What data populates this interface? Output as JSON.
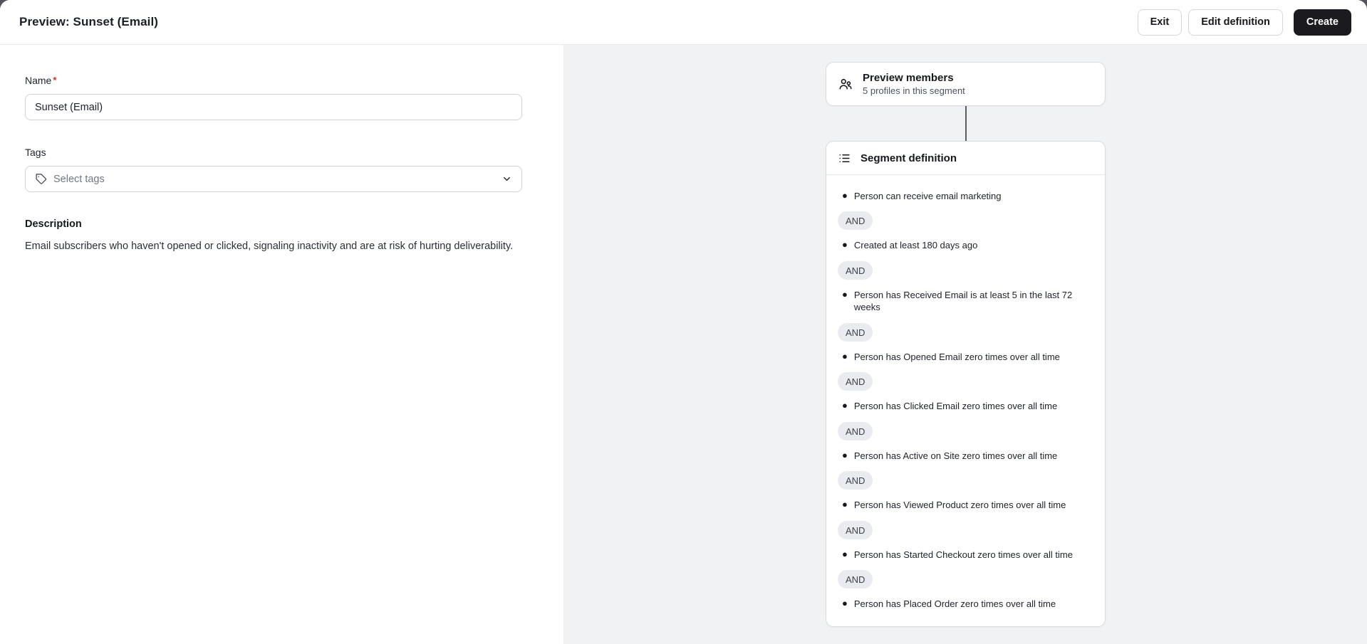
{
  "header": {
    "title": "Preview: Sunset (Email)",
    "exit_label": "Exit",
    "edit_definition_label": "Edit definition",
    "create_label": "Create"
  },
  "form": {
    "name": {
      "label": "Name",
      "required_marker": "*",
      "value": "Sunset (Email)"
    },
    "tags": {
      "label": "Tags",
      "placeholder": "Select tags"
    },
    "description": {
      "label": "Description",
      "text": "Email subscribers who haven't opened or clicked, signaling inactivity and are at risk of hurting deliverability."
    }
  },
  "preview_members": {
    "title": "Preview members",
    "subtitle": "5 profiles in this segment"
  },
  "segment_definition": {
    "title": "Segment definition",
    "operator": "AND",
    "conditions": [
      "Person can receive email marketing",
      "Created at least 180 days ago",
      "Person has Received Email is at least 5 in the last 72 weeks",
      "Person has Opened Email zero times over all time",
      "Person has Clicked Email zero times over all time",
      "Person has Active on Site zero times over all time",
      "Person has Viewed Product zero times over all time",
      "Person has Started Checkout zero times over all time",
      "Person has Placed Order zero times over all time"
    ]
  },
  "colors": {
    "backdrop": "#56525e",
    "canvas_bg": "#f1f2f4",
    "primary_button_bg": "#1b1b1f",
    "pill_bg": "#e9ebee",
    "required_red": "#d92d20",
    "connector": "#5c5d62"
  }
}
